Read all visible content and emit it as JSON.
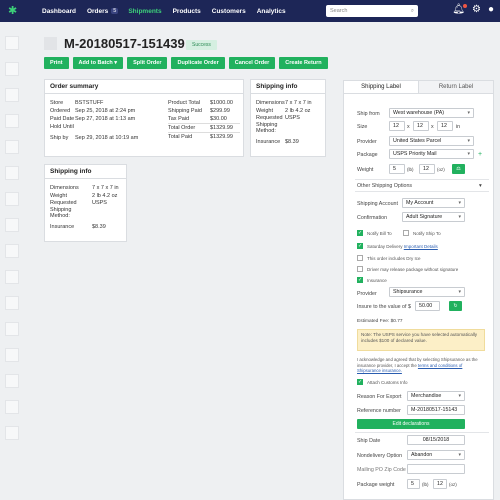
{
  "topbar": {
    "nav": [
      {
        "label": "Dashboard"
      },
      {
        "label": "Orders",
        "badge": "5"
      },
      {
        "label": "Shipments"
      },
      {
        "label": "Products"
      },
      {
        "label": "Customers"
      },
      {
        "label": "Analytics"
      }
    ],
    "search_placeholder": "Search"
  },
  "order": {
    "number": "M-20180517-151439",
    "status": "Success"
  },
  "actions": [
    "Print",
    "Add to Batch",
    "Split Order",
    "Duplicate Order",
    "Cancel Order",
    "Create Return"
  ],
  "order_summary": {
    "title": "Order summary",
    "left": [
      {
        "k": "Store",
        "v": "BSTSTUFF"
      },
      {
        "k": "Ordered",
        "v": "Sep 25, 2018 at 2:24 pm"
      },
      {
        "k": "Paid Date",
        "v": "Sep 27, 2018 at 1:13 am"
      },
      {
        "k": "Hold Until",
        "v": ""
      },
      {
        "k": "Ship by",
        "v": "Sep 29, 2018 at 10:19 am"
      }
    ],
    "right": [
      {
        "k": "Product Total",
        "v": "$1000.00"
      },
      {
        "k": "Shipping Paid",
        "v": "$299.99"
      },
      {
        "k": "Tax Paid",
        "v": "$30.00"
      },
      {
        "k": "Total Order",
        "v": "$1329.99"
      },
      {
        "k": "Total Paid",
        "v": "$1329.99"
      }
    ]
  },
  "shipping_info_1": {
    "title": "Shipping info",
    "rows": [
      {
        "k": "Dimensions",
        "v": "7 x 7 x 7 in"
      },
      {
        "k": "Weight",
        "v": "2 lb 4.2 oz"
      },
      {
        "k": "Requested Shipping Method:",
        "v": "USPS"
      },
      {
        "k": "Insurance",
        "v": "$8.39"
      }
    ]
  },
  "shipping_info_2": {
    "title": "Shipping info",
    "rows": [
      {
        "k": "Dimensions",
        "v": "7 x 7 x 7 in"
      },
      {
        "k": "Weight",
        "v": "2 lb 4.2 oz"
      },
      {
        "k": "Requested Shipping Method:",
        "v": "USPS"
      },
      {
        "k": "Insurance",
        "v": "$8.39"
      }
    ]
  },
  "panel": {
    "tabs": [
      "Shipping Label",
      "Return Label"
    ],
    "ship_from_label": "Ship from",
    "ship_from": "West warehouse (PA)",
    "size_label": "Size",
    "size": [
      "12",
      "12",
      "12"
    ],
    "size_unit": "in",
    "provider_label": "Provider",
    "provider": "United States Parcel",
    "package_label": "Package",
    "package": "USPS Priority Mail",
    "weight_label": "Weight",
    "weight_lb": "5",
    "weight_lb_unit": "(lb)",
    "weight_oz": "12",
    "weight_oz_unit": "(oz)",
    "other_options": "Other Shipping Options",
    "shipping_account_label": "Shipping Account",
    "shipping_account": "My Account",
    "confirmation_label": "Confirmation",
    "confirmation": "Adult Signature",
    "notify_bill_to": "Notify Bill To",
    "notify_ship_to": "Notify Ship To",
    "saturday_delivery": "Saturday Delivery",
    "saturday_link": "Important Details",
    "dry_ice": "This order includes Dry Ice",
    "release_package": "Driver may release package without signature",
    "insurance": "Insurance",
    "ins_provider_label": "Provider",
    "ins_provider": "Shipsurance",
    "insure_label": "Insure to the value of $",
    "insure_value": "50.00",
    "estimated_fee": "Estimated Fee: $0.77",
    "note": "Note: The USPS service you have selected automatically includes $100 of declared value.",
    "ack": "I acknowledge and agreed that by selecting Shipsurance as the insurance provider, I accept the",
    "ack_link": "terms and conditions of Shipsurance insurance.",
    "attach_customs": "Attach Customs Info",
    "reason_label": "Reason For Export",
    "reason": "Merchandise",
    "reference_label": "Reference number",
    "reference": "M-20180517-15143",
    "edit_declarations": "Edit declarations",
    "ship_date_label": "Ship Date",
    "ship_date": "08/15/2018",
    "nondelivery_label": "Nondelivery Option",
    "nondelivery": "Abandon",
    "mailing_po_label": "Mailing PO Zip Code",
    "mailing_po": "",
    "pkg_weight_label": "Package weight",
    "pkg_weight_lb": "5",
    "pkg_weight_lb_unit": "(lb)",
    "pkg_weight_oz": "12",
    "pkg_weight_oz_unit": "(oz)"
  },
  "colors": {
    "navy": "#1d2657",
    "green": "#21b15e",
    "accent": "#3dd17a"
  }
}
